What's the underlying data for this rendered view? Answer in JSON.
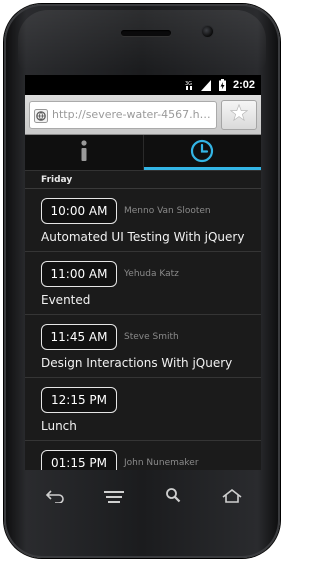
{
  "status_bar": {
    "time": "2:02",
    "icons": [
      "signal-3g-icon",
      "signal-bars-icon",
      "battery-charging-icon"
    ]
  },
  "browser": {
    "url": "http://severe-water-4567.hero...",
    "url_icon": "globe-icon",
    "bookmark_icon": "star-icon"
  },
  "tabs": [
    {
      "icon": "info-icon",
      "active": false
    },
    {
      "icon": "clock-icon",
      "active": true
    }
  ],
  "schedule": {
    "day": "Friday",
    "sessions": [
      {
        "time": "10:00 AM",
        "speaker": "Menno Van Slooten",
        "title": "Automated UI Testing With jQuery"
      },
      {
        "time": "11:00 AM",
        "speaker": "Yehuda Katz",
        "title": "Evented"
      },
      {
        "time": "11:45 AM",
        "speaker": "Steve Smith",
        "title": "Design Interactions With jQuery"
      },
      {
        "time": "12:15 PM",
        "speaker": "",
        "title": "Lunch"
      },
      {
        "time": "01:15 PM",
        "speaker": "John Nunemaker",
        "title": ""
      }
    ]
  },
  "nav_buttons": [
    "back-icon",
    "menu-icon",
    "search-icon",
    "home-icon"
  ],
  "colors": {
    "accent": "#33b5e5",
    "screen_bg": "#1b1b1b"
  }
}
